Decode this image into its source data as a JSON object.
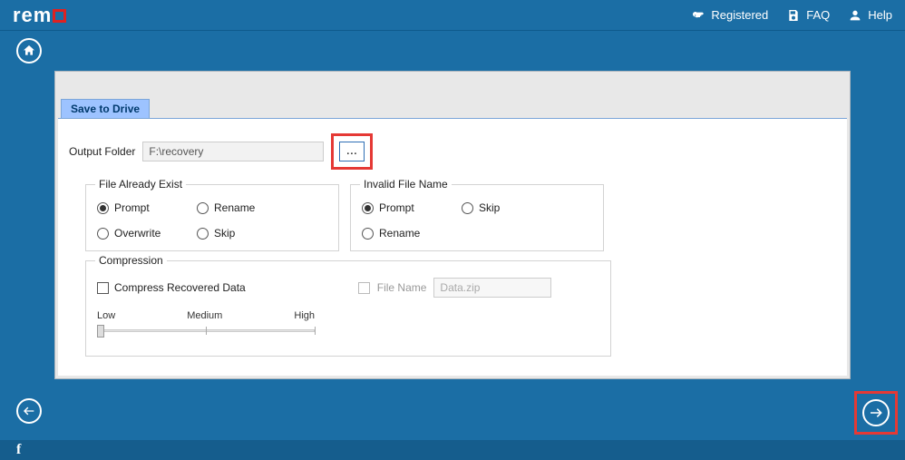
{
  "brand": {
    "name_part": "rem"
  },
  "topbar": {
    "registered": "Registered",
    "faq": "FAQ",
    "help": "Help"
  },
  "tab": {
    "save": "Save to Drive"
  },
  "output": {
    "label": "Output Folder",
    "value": "F:\\recovery",
    "browse": "..."
  },
  "groups": {
    "exist_title": "File Already Exist",
    "invalid_title": "Invalid File Name",
    "compress_title": "Compression"
  },
  "exist": {
    "selected": "prompt",
    "prompt": "Prompt",
    "rename": "Rename",
    "overwrite": "Overwrite",
    "skip": "Skip"
  },
  "invalid": {
    "selected": "prompt",
    "prompt": "Prompt",
    "skip": "Skip",
    "rename": "Rename"
  },
  "compress": {
    "checkbox_label": "Compress Recovered Data",
    "checked": false,
    "filename_label": "File Name",
    "filename_value": "Data.zip",
    "slider": {
      "low": "Low",
      "medium": "Medium",
      "high": "High"
    }
  }
}
